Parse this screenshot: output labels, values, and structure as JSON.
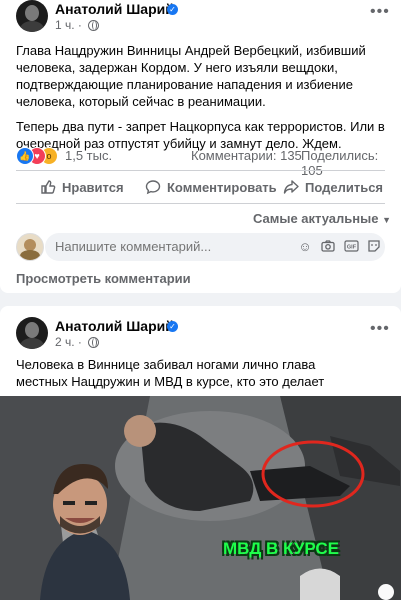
{
  "post1": {
    "author": "Анатолий Шарий",
    "time": "1 ч.",
    "paragraph1": "Глава Нацдружин Винницы Андрей Вербецкий, избивший человека, задержан Кордом. У него изъяли вещдоки, подтверждающие планирование нападения и избиение человека, который сейчас в реанимации.",
    "paragraph2": "Теперь два пути - запрет Нацкорпуса как террористов. Или в очередной раз отпустят убийцу и замнут дело. Ждем.",
    "reaction_count": "1,5 тыс.",
    "comments_count": "Комментарии: 135",
    "shares_count": "Поделились: 105",
    "actions": {
      "like": "Нравится",
      "comment": "Комментировать",
      "share": "Поделиться"
    },
    "sort_label": "Самые актуальные",
    "comment_placeholder": "Напишите комментарий...",
    "view_comments": "Просмотреть комментарии"
  },
  "post2": {
    "author": "Анатолий Шарий",
    "time": "2 ч.",
    "text": "Человека в Виннице забивал ногами лично глава местных Нацдружин и МВД в курсе, кто это делает",
    "video_caption": "МВД В КУРСЕ"
  },
  "icons": {
    "more": "more-icon",
    "verified": "verified-badge-icon",
    "globe": "globe-icon"
  },
  "colors": {
    "accent": "#1877f2",
    "secondary_text": "#65676b",
    "caption_green": "#1eff4b"
  }
}
